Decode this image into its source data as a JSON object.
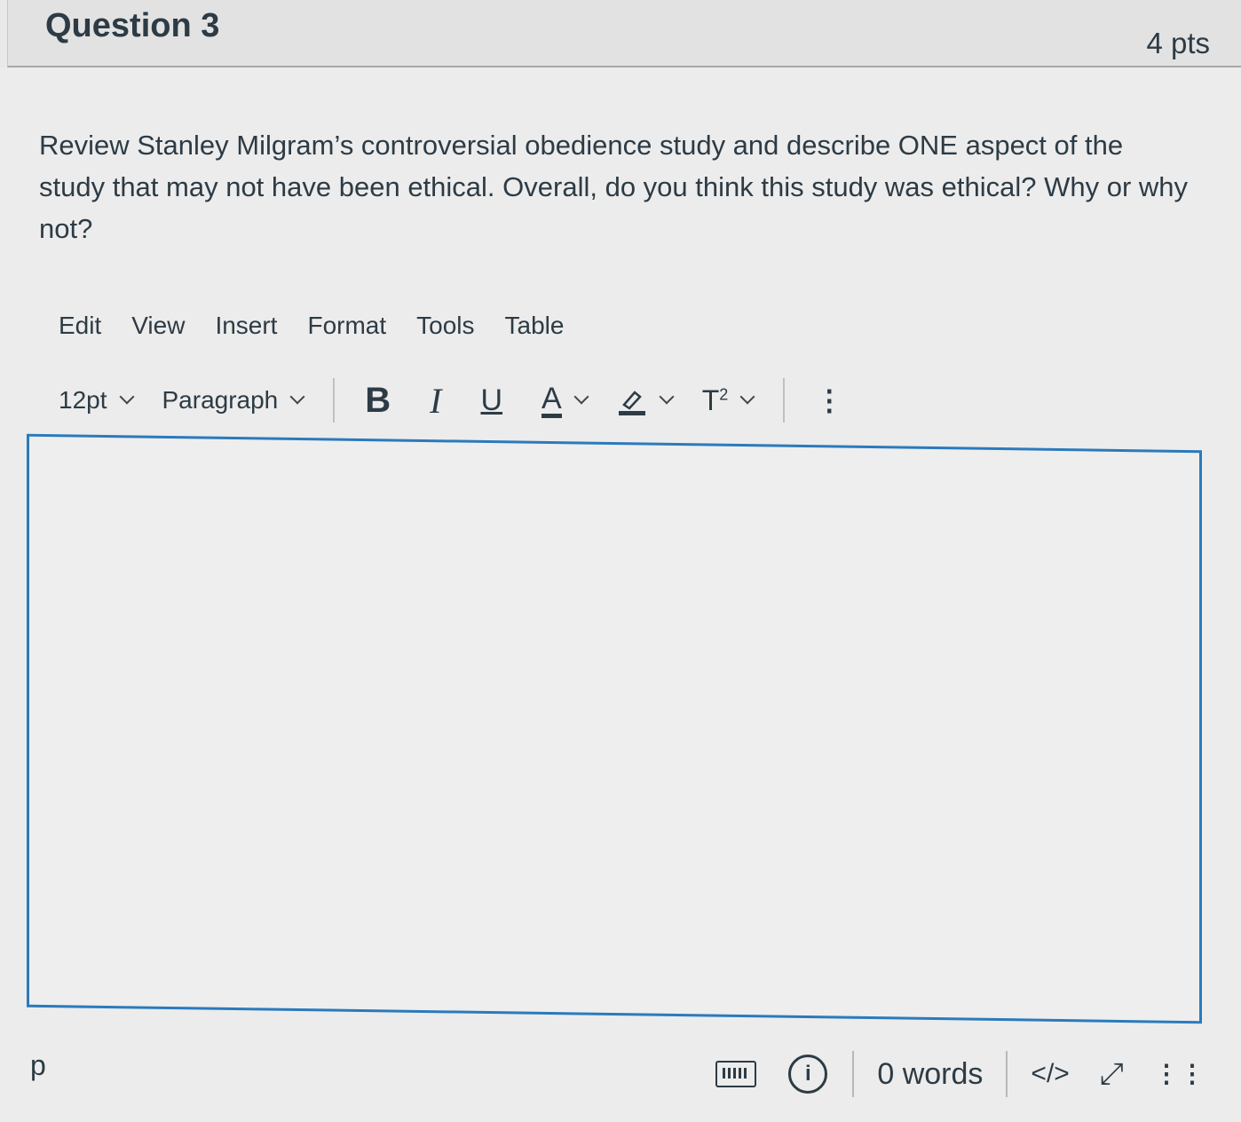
{
  "question": {
    "title": "Question 3",
    "points": "4 pts",
    "text": "Review Stanley Milgram’s controversial obedience study and describe ONE aspect of the study that may not have been ethical. Overall, do you think this study was ethical? Why or why not?"
  },
  "editor": {
    "menu": [
      "Edit",
      "View",
      "Insert",
      "Format",
      "Tools",
      "Table"
    ],
    "toolbar": {
      "font_size": "12pt",
      "block_format": "Paragraph",
      "bold": "B",
      "italic": "I",
      "underline": "U",
      "text_color": "A",
      "superscript": "T",
      "superscript_exp": "2",
      "more": "⋮"
    },
    "accent_color": "#2b7abc",
    "content": ""
  },
  "status_bar": {
    "path": "p",
    "word_count": "0 words",
    "html_toggle": "</>",
    "fullscreen": "⤢",
    "grip": "⋮⋮"
  }
}
